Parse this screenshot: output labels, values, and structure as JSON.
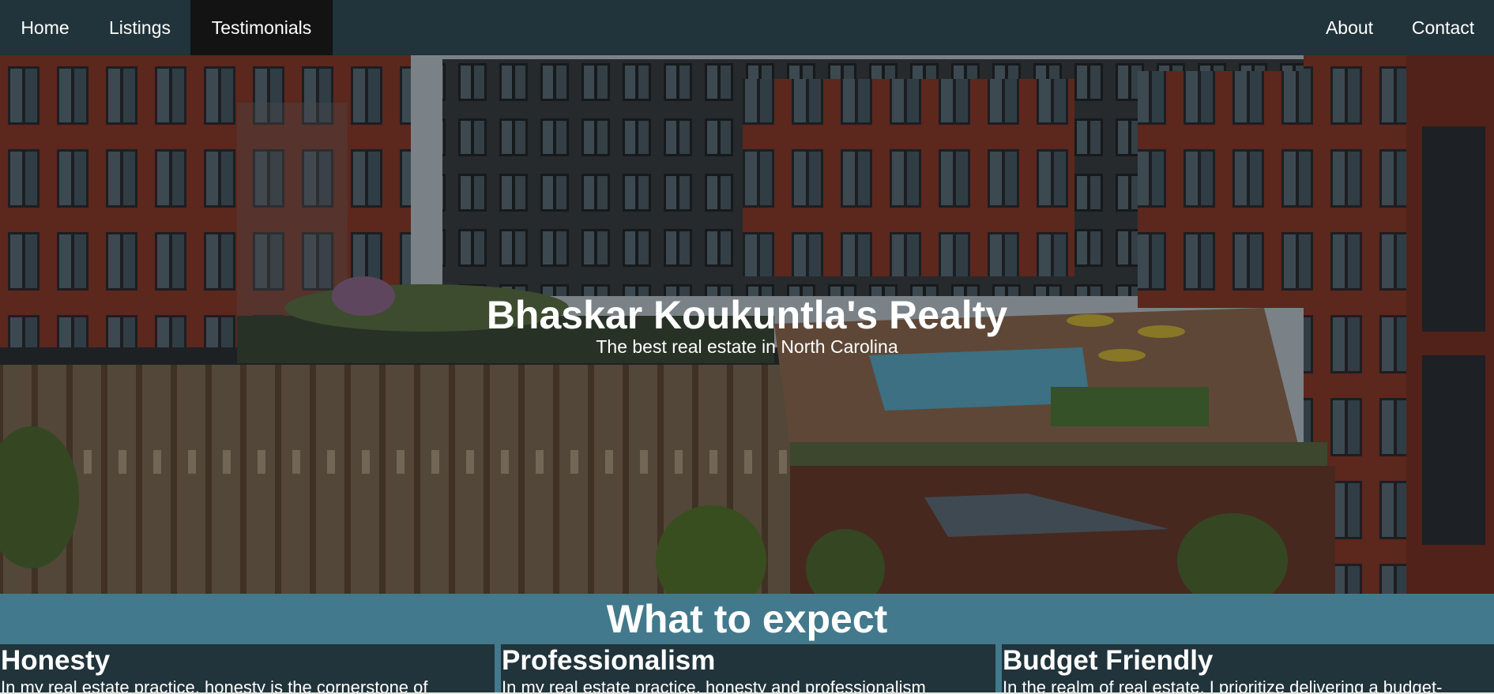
{
  "nav": {
    "left": [
      {
        "label": "Home"
      },
      {
        "label": "Listings"
      },
      {
        "label": "Testimonials",
        "active": true
      }
    ],
    "right": [
      {
        "label": "About"
      },
      {
        "label": "Contact"
      }
    ]
  },
  "hero": {
    "title": "Bhaskar Koukuntla's Realty",
    "subtitle": "The best real estate in North Carolina",
    "background_image": "apartment-complex-rooftop-pool-photo"
  },
  "expect": {
    "heading": "What to expect",
    "cards": [
      {
        "title": "Honesty",
        "text": "In my real estate practice, honesty is the cornerstone of"
      },
      {
        "title": "Professionalism",
        "text": "In my real estate practice, honesty and professionalism"
      },
      {
        "title": "Budget Friendly",
        "text": "In the realm of real estate, I prioritize delivering a budget-"
      }
    ]
  },
  "colors": {
    "nav_bg": "#21333b",
    "nav_active_bg": "#131313",
    "section_bg": "#42798c",
    "card_bg": "#21333b",
    "text": "#ffffff"
  }
}
